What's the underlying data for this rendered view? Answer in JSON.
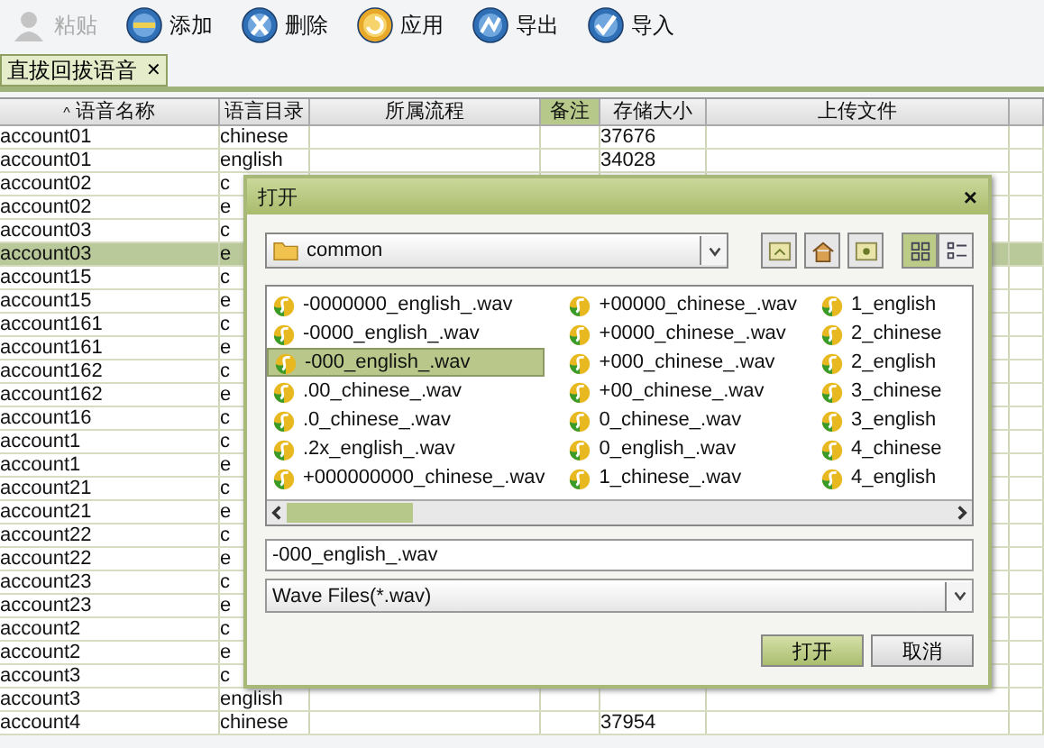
{
  "toolbar": [
    {
      "label": "粘贴",
      "disabled": true
    },
    {
      "label": "添加",
      "disabled": false
    },
    {
      "label": "删除",
      "disabled": false
    },
    {
      "label": "应用",
      "disabled": false
    },
    {
      "label": "导出",
      "disabled": false
    },
    {
      "label": "导入",
      "disabled": false
    }
  ],
  "tabs": [
    {
      "label": "直拔回拔语音",
      "selected": true,
      "close": "✕"
    }
  ],
  "table": {
    "columns": [
      {
        "label": "语音名称",
        "sort": "^",
        "highlighted": false
      },
      {
        "label": "语言目录",
        "highlighted": false
      },
      {
        "label": "所属流程",
        "highlighted": false
      },
      {
        "label": "备注",
        "highlighted": true
      },
      {
        "label": "存储大小",
        "highlighted": false
      },
      {
        "label": "上传文件",
        "highlighted": false
      }
    ],
    "rows": [
      {
        "name": "account01",
        "language": "chinese",
        "size": "37676",
        "selected": false
      },
      {
        "name": "account01",
        "language": "english",
        "size": "34028",
        "selected": false
      },
      {
        "name": "account02",
        "language": "c",
        "selected": false
      },
      {
        "name": "account02",
        "language": "e",
        "selected": false
      },
      {
        "name": "account03",
        "language": "c",
        "selected": false
      },
      {
        "name": "account03",
        "language": "e",
        "selected": true
      },
      {
        "name": "account15",
        "language": "c",
        "selected": false
      },
      {
        "name": "account15",
        "language": "e",
        "selected": false
      },
      {
        "name": "account161",
        "language": "c",
        "selected": false
      },
      {
        "name": "account161",
        "language": "e",
        "selected": false
      },
      {
        "name": "account162",
        "language": "c",
        "selected": false
      },
      {
        "name": "account162",
        "language": "e",
        "selected": false
      },
      {
        "name": "account16",
        "language": "c",
        "selected": false
      },
      {
        "name": "account1",
        "language": "c",
        "selected": false
      },
      {
        "name": "account1",
        "language": "e",
        "selected": false
      },
      {
        "name": "account21",
        "language": "c",
        "selected": false
      },
      {
        "name": "account21",
        "language": "e",
        "selected": false
      },
      {
        "name": "account22",
        "language": "c",
        "selected": false
      },
      {
        "name": "account22",
        "language": "e",
        "selected": false
      },
      {
        "name": "account23",
        "language": "c",
        "selected": false
      },
      {
        "name": "account23",
        "language": "e",
        "selected": false
      },
      {
        "name": "account2",
        "language": "c",
        "selected": false
      },
      {
        "name": "account2",
        "language": "e",
        "selected": false
      },
      {
        "name": "account3",
        "language": "c",
        "selected": false
      },
      {
        "name": "account3",
        "language": "english",
        "selected": false
      },
      {
        "name": "account4",
        "language": "chinese",
        "size": "37954",
        "selected": false
      }
    ]
  },
  "dialog": {
    "title": "打开",
    "close": "×",
    "folder": "common",
    "files": [
      {
        "name": "-0000000_english_.wav",
        "selected": false
      },
      {
        "name": "-0000_english_.wav",
        "selected": false
      },
      {
        "name": "-000_english_.wav",
        "selected": true
      },
      {
        "name": ".00_chinese_.wav",
        "selected": false
      },
      {
        "name": ".0_chinese_.wav",
        "selected": false
      },
      {
        "name": ".2x_english_.wav",
        "selected": false
      },
      {
        "name": "+000000000_chinese_.wav",
        "selected": false
      },
      {
        "name": "+00000_chinese_.wav",
        "selected": false
      },
      {
        "name": "+0000_chinese_.wav",
        "selected": false
      },
      {
        "name": "+000_chinese_.wav",
        "selected": false
      },
      {
        "name": "+00_chinese_.wav",
        "selected": false
      },
      {
        "name": "0_chinese_.wav",
        "selected": false
      },
      {
        "name": "0_english_.wav",
        "selected": false
      },
      {
        "name": "1_chinese_.wav",
        "selected": false
      },
      {
        "name": "1_english",
        "selected": false
      },
      {
        "name": "2_chinese",
        "selected": false
      },
      {
        "name": "2_english",
        "selected": false
      },
      {
        "name": "3_chinese",
        "selected": false
      },
      {
        "name": "3_english",
        "selected": false
      },
      {
        "name": "4_chinese",
        "selected": false
      },
      {
        "name": "4_english",
        "selected": false
      }
    ],
    "view_list_selected": true,
    "file_name": "-000_english_.wav",
    "file_type": "Wave Files(*.wav)",
    "buttons": [
      {
        "label": "打开",
        "primary": true
      },
      {
        "label": "取消",
        "primary": false
      }
    ]
  }
}
